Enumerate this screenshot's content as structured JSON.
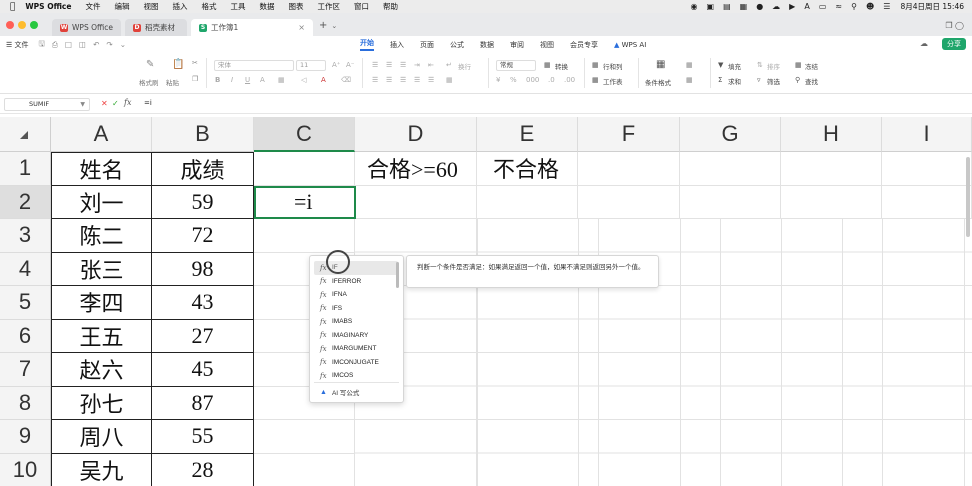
{
  "menubar": {
    "app_name": "WPS Office",
    "items": [
      "文件",
      "编辑",
      "视图",
      "插入",
      "格式",
      "工具",
      "数据",
      "图表",
      "工作区",
      "窗口",
      "帮助"
    ],
    "datetime": "8月4日周日 15:46"
  },
  "tabs": [
    {
      "label": "WPS Office",
      "icon_color": "#e0413a"
    },
    {
      "label": "稻壳素材",
      "icon_color": "#e0413a"
    },
    {
      "label": "工作簿1",
      "icon_color": "#1fa66b"
    }
  ],
  "ribbon": {
    "file_label": "文件",
    "tabs": [
      "开始",
      "插入",
      "页面",
      "公式",
      "数据",
      "审阅",
      "视图",
      "会员专享"
    ],
    "active_tab": "开始",
    "wps_ai": "WPS AI",
    "share": "分享"
  },
  "toolbar": {
    "format_painter": "格式刷",
    "paste": "粘贴",
    "font_name": "宋体",
    "font_size": "11",
    "wrap": "换行",
    "number_format": "常规",
    "convert": "转换",
    "rows_cols": "行和列",
    "worksheet": "工作表",
    "cond_format": "条件格式",
    "fill": "填充",
    "sort": "排序",
    "freeze": "冻结",
    "sum": "求和",
    "filter": "筛选",
    "find": "查找"
  },
  "formula_bar": {
    "name_box": "SUMIF",
    "fx": "fx",
    "value": "=i"
  },
  "grid": {
    "columns": [
      "A",
      "B",
      "C",
      "D",
      "E",
      "F",
      "G",
      "H",
      "I"
    ],
    "rows": [
      "1",
      "2",
      "3",
      "4",
      "5",
      "6",
      "7",
      "8",
      "9",
      "10"
    ],
    "cells": {
      "A1": "姓名",
      "B1": "成绩",
      "D1": "合格>=60",
      "E1": "不合格",
      "A2": "刘一",
      "B2": "59",
      "A3": "陈二",
      "B3": "72",
      "A4": "张三",
      "B4": "98",
      "A5": "李四",
      "B5": "43",
      "A6": "王五",
      "B6": "27",
      "A7": "赵六",
      "B7": "45",
      "A8": "孙七",
      "B8": "87",
      "A9": "周八",
      "B9": "55",
      "A10": "吴九",
      "B10": "28",
      "C2": "=i"
    }
  },
  "autocomplete": {
    "items": [
      "IF",
      "IFERROR",
      "IFNA",
      "IFS",
      "IMABS",
      "IMAGINARY",
      "IMARGUMENT",
      "IMCONJUGATE",
      "IMCOS"
    ],
    "selected": "IF",
    "ai_item": "AI 写公式",
    "tooltip": "判断一个条件是否满足：如果满足返回一个值，如果不满足则返回另外一个值。"
  }
}
